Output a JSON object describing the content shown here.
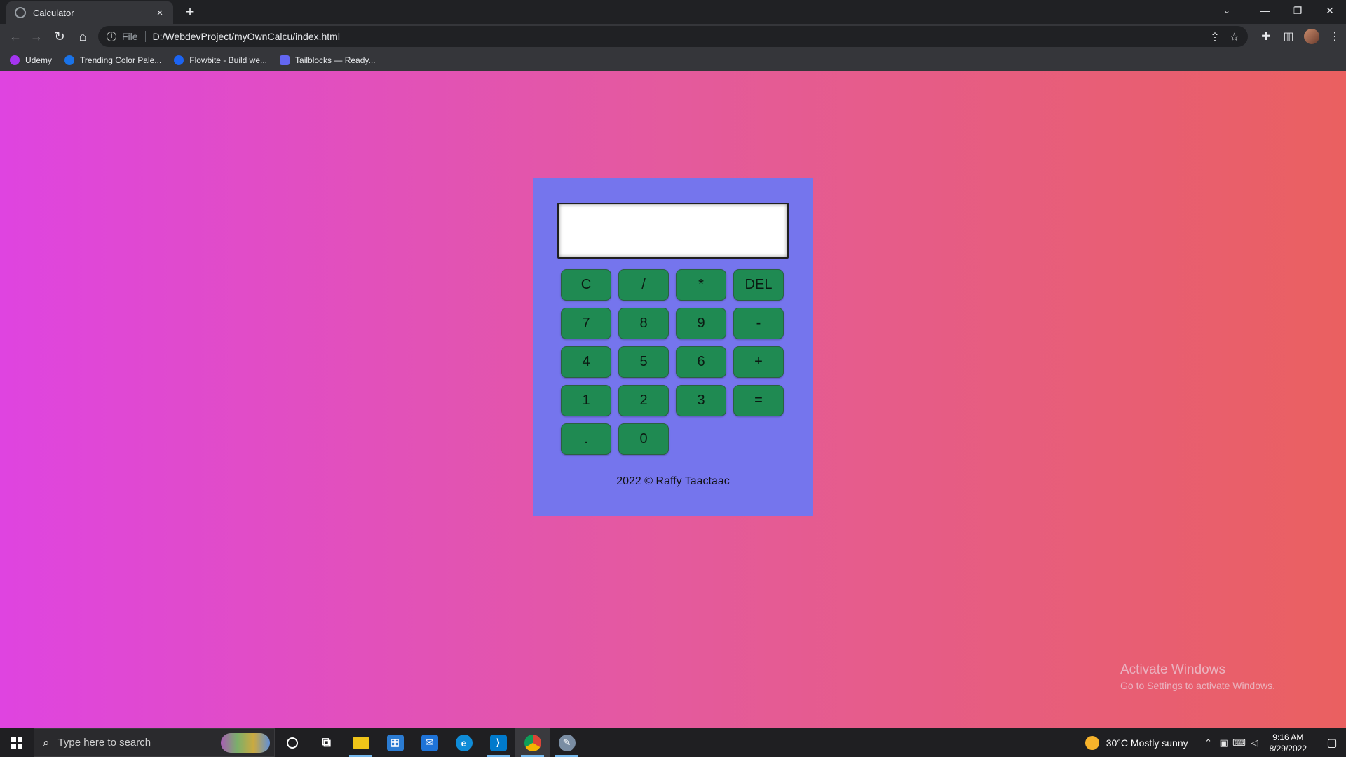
{
  "browser": {
    "tab_title": "Calculator",
    "tab_close": "×",
    "new_tab": "+",
    "url_scheme": "File",
    "url": "D:/WebdevProject/myOwnCalcu/index.html",
    "bookmarks": [
      {
        "label": "Udemy",
        "color": "#a435f0"
      },
      {
        "label": "Trending Color Pale...",
        "color": "#1a73e8"
      },
      {
        "label": "Flowbite - Build we...",
        "color": "#1c64f2"
      },
      {
        "label": "Tailblocks — Ready...",
        "color": "#6366f1"
      }
    ]
  },
  "calculator": {
    "display_value": "",
    "keys": [
      "C",
      "/",
      "*",
      "DEL",
      "7",
      "8",
      "9",
      "-",
      "4",
      "5",
      "6",
      "+",
      "1",
      "2",
      "3",
      "=",
      ".",
      "0"
    ],
    "footer": "2022 © Raffy Taactaac"
  },
  "watermark": {
    "line1": "Activate Windows",
    "line2": "Go to Settings to activate Windows."
  },
  "taskbar": {
    "search_placeholder": "Type here to search",
    "apps": [
      {
        "name": "cortana-icon",
        "glyph": "○",
        "color": "transparent"
      },
      {
        "name": "task-view-icon",
        "glyph": "⧉",
        "color": "transparent"
      },
      {
        "name": "file-explorer-icon",
        "glyph": "▬",
        "color": "#f0c419"
      },
      {
        "name": "microsoft-store-icon",
        "glyph": "▦",
        "color": "#2b7cd3"
      },
      {
        "name": "mail-icon",
        "glyph": "✉",
        "color": "#1e73d8"
      },
      {
        "name": "edge-icon",
        "glyph": "e",
        "color": "#0f8cd8"
      },
      {
        "name": "vscode-icon",
        "glyph": "⟩",
        "color": "#007acc"
      },
      {
        "name": "chrome-icon",
        "glyph": "◉",
        "color": "#db4437"
      },
      {
        "name": "paint-icon",
        "glyph": "✎",
        "color": "#7a8da3"
      }
    ],
    "weather": "30°C  Mostly sunny",
    "time": "9:16 AM",
    "date": "8/29/2022"
  }
}
